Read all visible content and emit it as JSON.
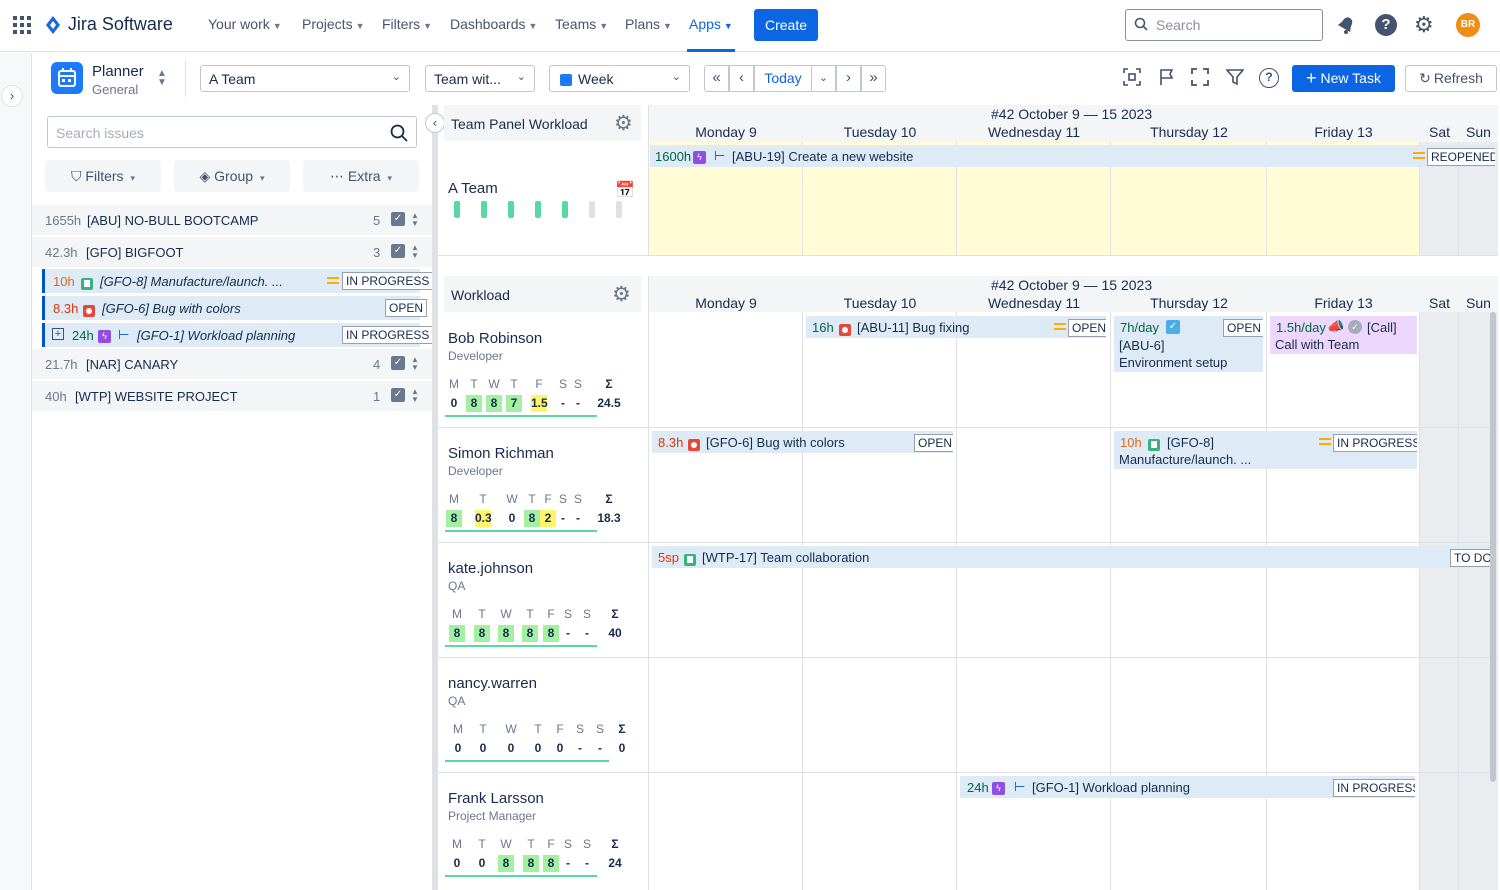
{
  "nav": {
    "app_name": "Jira Software",
    "items": [
      "Your work",
      "Projects",
      "Filters",
      "Dashboards",
      "Teams",
      "Plans",
      "Apps"
    ],
    "create_label": "Create",
    "search_placeholder": "Search",
    "avatar_initials": "BR"
  },
  "toolbar": {
    "planner_title": "Planner",
    "planner_subtitle": "General",
    "team_select": "A Team",
    "team_with": "Team wit...",
    "view_select": "Week",
    "today_label": "Today",
    "new_task_label": "New Task",
    "refresh_label": "Refresh"
  },
  "left_panel": {
    "search_placeholder": "Search issues",
    "filters_label": "Filters",
    "group_label": "Group",
    "extra_label": "Extra",
    "projects": [
      {
        "hours": "1655h",
        "name": "[ABU] NO-BULL BOOTCAMP",
        "count": "5"
      },
      {
        "hours": "42.3h",
        "name": "[GFO] BIGFOOT",
        "count": "3"
      },
      {
        "hours": "21.7h",
        "name": "[NAR] CANARY",
        "count": "4"
      },
      {
        "hours": "40h",
        "name": "[WTP] WEBSITE PROJECT",
        "count": "1"
      }
    ],
    "issues": [
      {
        "hours": "10h",
        "title": "[GFO-8] Manufacture/launch. ...",
        "status": "IN PROGRESS"
      },
      {
        "hours": "8.3h",
        "title": "[GFO-6] Bug with colors",
        "status": "OPEN"
      },
      {
        "hours": "24h",
        "title": "[GFO-1] Workload planning",
        "status": "IN PROGRESS"
      }
    ]
  },
  "calendar": {
    "week_title": "#42 October 9 — 15 2023",
    "days": [
      "Monday 9",
      "Tuesday 10",
      "Wednesday 11",
      "Thursday 12",
      "Friday 13",
      "Sat",
      "Sun"
    ],
    "team_panel_title": "Team Panel Workload",
    "team_name": "A Team",
    "workload_title": "Workload",
    "team_bar": {
      "hours": "1600h",
      "title": "[ABU-19] Create a new website",
      "status": "REOPENED"
    }
  },
  "people": [
    {
      "name": "Bob Robinson",
      "role": "Developer",
      "days": [
        "M",
        "T",
        "W",
        "T",
        "F",
        "S",
        "S",
        "Σ"
      ],
      "values": [
        "0",
        "8",
        "8",
        "7",
        "1.5",
        "-",
        "-",
        "24.5"
      ]
    },
    {
      "name": "Simon Richman",
      "role": "Developer",
      "days": [
        "M",
        "T",
        "W",
        "T",
        "F",
        "S",
        "S",
        "Σ"
      ],
      "values": [
        "8",
        "0.3",
        "0",
        "8",
        "2",
        "-",
        "-",
        "18.3"
      ]
    },
    {
      "name": "kate.johnson",
      "role": "QA",
      "days": [
        "M",
        "T",
        "W",
        "T",
        "F",
        "S",
        "S",
        "Σ"
      ],
      "values": [
        "8",
        "8",
        "8",
        "8",
        "8",
        "-",
        "-",
        "40"
      ]
    },
    {
      "name": "nancy.warren",
      "role": "QA",
      "days": [
        "M",
        "T",
        "W",
        "T",
        "F",
        "S",
        "S",
        "Σ"
      ],
      "values": [
        "0",
        "0",
        "0",
        "0",
        "0",
        "-",
        "-",
        "0"
      ]
    },
    {
      "name": "Frank Larsson",
      "role": "Project Manager",
      "days": [
        "M",
        "T",
        "W",
        "T",
        "F",
        "S",
        "S",
        "Σ"
      ],
      "values": [
        "0",
        "0",
        "8",
        "8",
        "8",
        "-",
        "-",
        "24"
      ]
    }
  ],
  "tasks": {
    "bob_bug": {
      "hours": "16h",
      "title": "[ABU-11] Bug fixing",
      "status": "OPEN"
    },
    "bob_env": {
      "hours": "7h/day",
      "title": "[ABU-6]",
      "title2": "Environment setup",
      "status": "OPEN"
    },
    "bob_call": {
      "hours": "1.5h/day",
      "title": "[Call]",
      "title2": "Call with Team"
    },
    "simon_bug": {
      "hours": "8.3h",
      "title": "[GFO-6] Bug with colors",
      "status": "OPEN"
    },
    "simon_story": {
      "hours": "10h",
      "title": "[GFO-8]",
      "title2": "Manufacture/launch. ...",
      "status": "IN PROGRESS"
    },
    "kate_story": {
      "hours": "5sp",
      "title": "[WTP-17] Team collaboration",
      "status": "TO DO"
    },
    "frank_epic": {
      "hours": "24h",
      "title": "[GFO-1] Workload planning",
      "status": "IN PROGRESS"
    }
  },
  "colors": {
    "accent": "#0c66e4",
    "green": "#a3f0a3",
    "yellow": "#fff56a",
    "bar": "#deebf7",
    "highlight": "#fffcd6"
  }
}
